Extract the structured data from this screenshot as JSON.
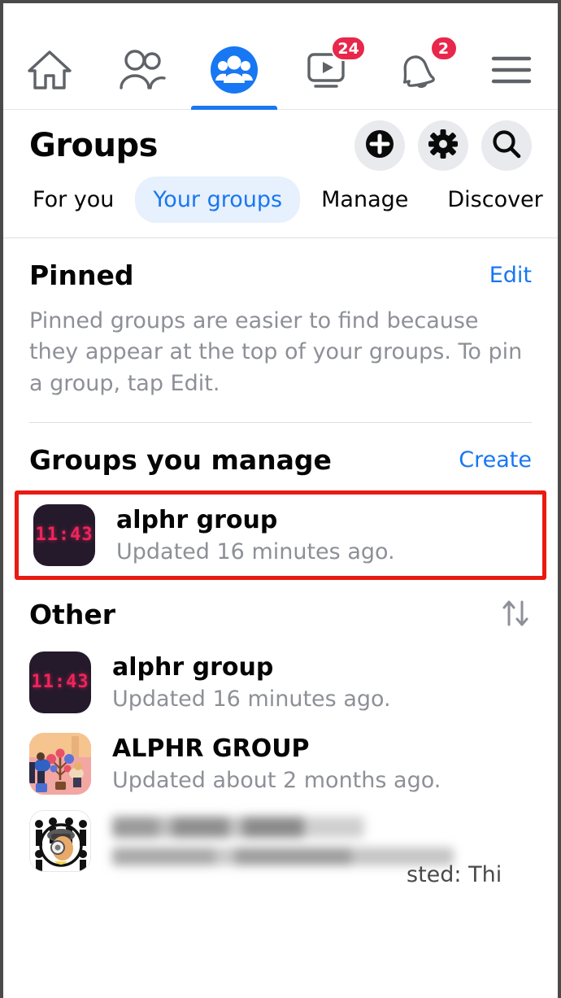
{
  "navbar": {
    "items": [
      {
        "name": "home",
        "icon": "home-icon",
        "badge": null,
        "active": false
      },
      {
        "name": "friends",
        "icon": "friends-icon",
        "badge": null,
        "active": false
      },
      {
        "name": "groups",
        "icon": "groups-icon",
        "badge": null,
        "active": true
      },
      {
        "name": "video",
        "icon": "video-icon",
        "badge": "24",
        "active": false
      },
      {
        "name": "notifications",
        "icon": "bell-icon",
        "badge": "2",
        "active": false
      },
      {
        "name": "menu",
        "icon": "hamburger-menu-icon",
        "badge": null,
        "active": false
      }
    ]
  },
  "header": {
    "title": "Groups",
    "actions": [
      {
        "name": "create-group-button",
        "icon": "plus-circle-icon"
      },
      {
        "name": "group-settings-button",
        "icon": "gear-icon"
      },
      {
        "name": "search-groups-button",
        "icon": "search-icon"
      }
    ]
  },
  "tabs": [
    {
      "label": "For you",
      "active": false
    },
    {
      "label": "Your groups",
      "active": true
    },
    {
      "label": "Manage",
      "active": false
    },
    {
      "label": "Discover",
      "active": false
    }
  ],
  "pinned": {
    "title": "Pinned",
    "action": "Edit",
    "description": "Pinned groups are easier to find because they appear at the top of your groups. To pin a group, tap Edit."
  },
  "managed": {
    "title": "Groups you manage",
    "action": "Create",
    "items": [
      {
        "name": "alphr group",
        "subtitle": "Updated 16 minutes ago.",
        "avatar": "clock-avatar",
        "avatar_text": "11:43",
        "highlighted": true
      }
    ]
  },
  "other": {
    "title": "Other",
    "sort_icon": "sort-arrows-icon",
    "items": [
      {
        "name": "alphr group",
        "subtitle": "Updated 16 minutes ago.",
        "avatar": "clock-avatar",
        "avatar_text": "11:43"
      },
      {
        "name": "ALPHR GROUP",
        "subtitle": "Updated about 2 months ago.",
        "avatar": "illustration-avatar",
        "avatar_text": ""
      },
      {
        "name": "",
        "subtitle": "",
        "avatar": "logo-avatar",
        "avatar_text": "",
        "blurred": true,
        "tail_text": "sted: Thi"
      }
    ]
  },
  "colors": {
    "accent": "#1877f2",
    "badge": "#e8274b",
    "highlight": "#e81b12",
    "muted_text": "#8d9096",
    "primary_text": "#050505",
    "pill_bg": "#e7f0fd",
    "button_bg": "#e9eaee"
  }
}
